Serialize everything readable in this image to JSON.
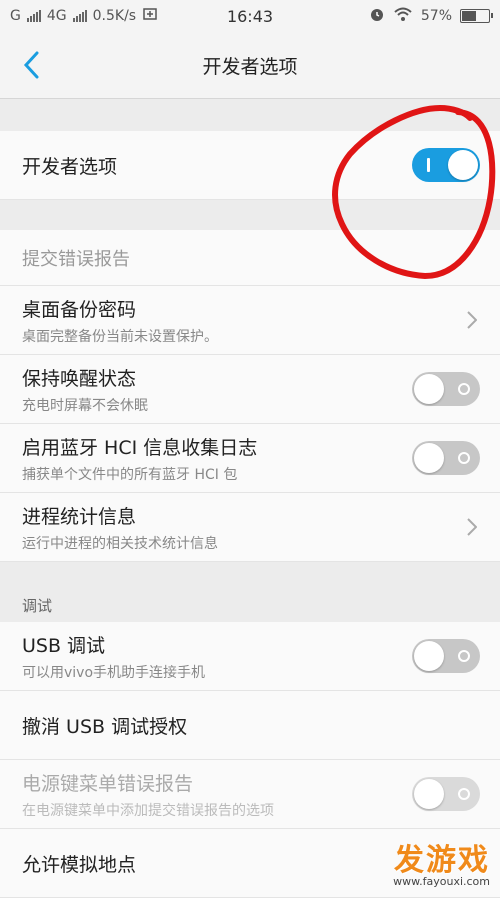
{
  "status_bar": {
    "carrier1": "G",
    "carrier2": "4G",
    "speed": "0.5K/s",
    "time": "16:43",
    "battery": "57%",
    "battery_level": 0.57
  },
  "header": {
    "title": "开发者选项"
  },
  "master_toggle": {
    "label": "开发者选项",
    "state": "on"
  },
  "items": [
    {
      "label": "提交错误报告"
    },
    {
      "label": "桌面备份密码",
      "sub": "桌面完整备份当前未设置保护。"
    },
    {
      "label": "保持唤醒状态",
      "sub": "充电时屏幕不会休眠",
      "state": "off"
    },
    {
      "label": "启用蓝牙 HCI 信息收集日志",
      "sub": "捕获单个文件中的所有蓝牙 HCI 包",
      "state": "off"
    },
    {
      "label": "进程统计信息",
      "sub": "运行中进程的相关技术统计信息"
    }
  ],
  "debug_section": {
    "title": "调试",
    "items": [
      {
        "label": "USB 调试",
        "sub": "可以用vivo手机助手连接手机",
        "state": "off"
      },
      {
        "label": "撤消 USB 调试授权"
      },
      {
        "label": "电源键菜单错误报告",
        "sub": "在电源键菜单中添加提交错误报告的选项",
        "state": "disabled"
      },
      {
        "label": "允许模拟地点"
      }
    ]
  },
  "watermark": {
    "main": "发游戏",
    "sub": "www.fayouxi.com"
  },
  "colors": {
    "accent": "#1a9de0",
    "annotation": "#e01515",
    "watermark": "#f08a1a"
  }
}
